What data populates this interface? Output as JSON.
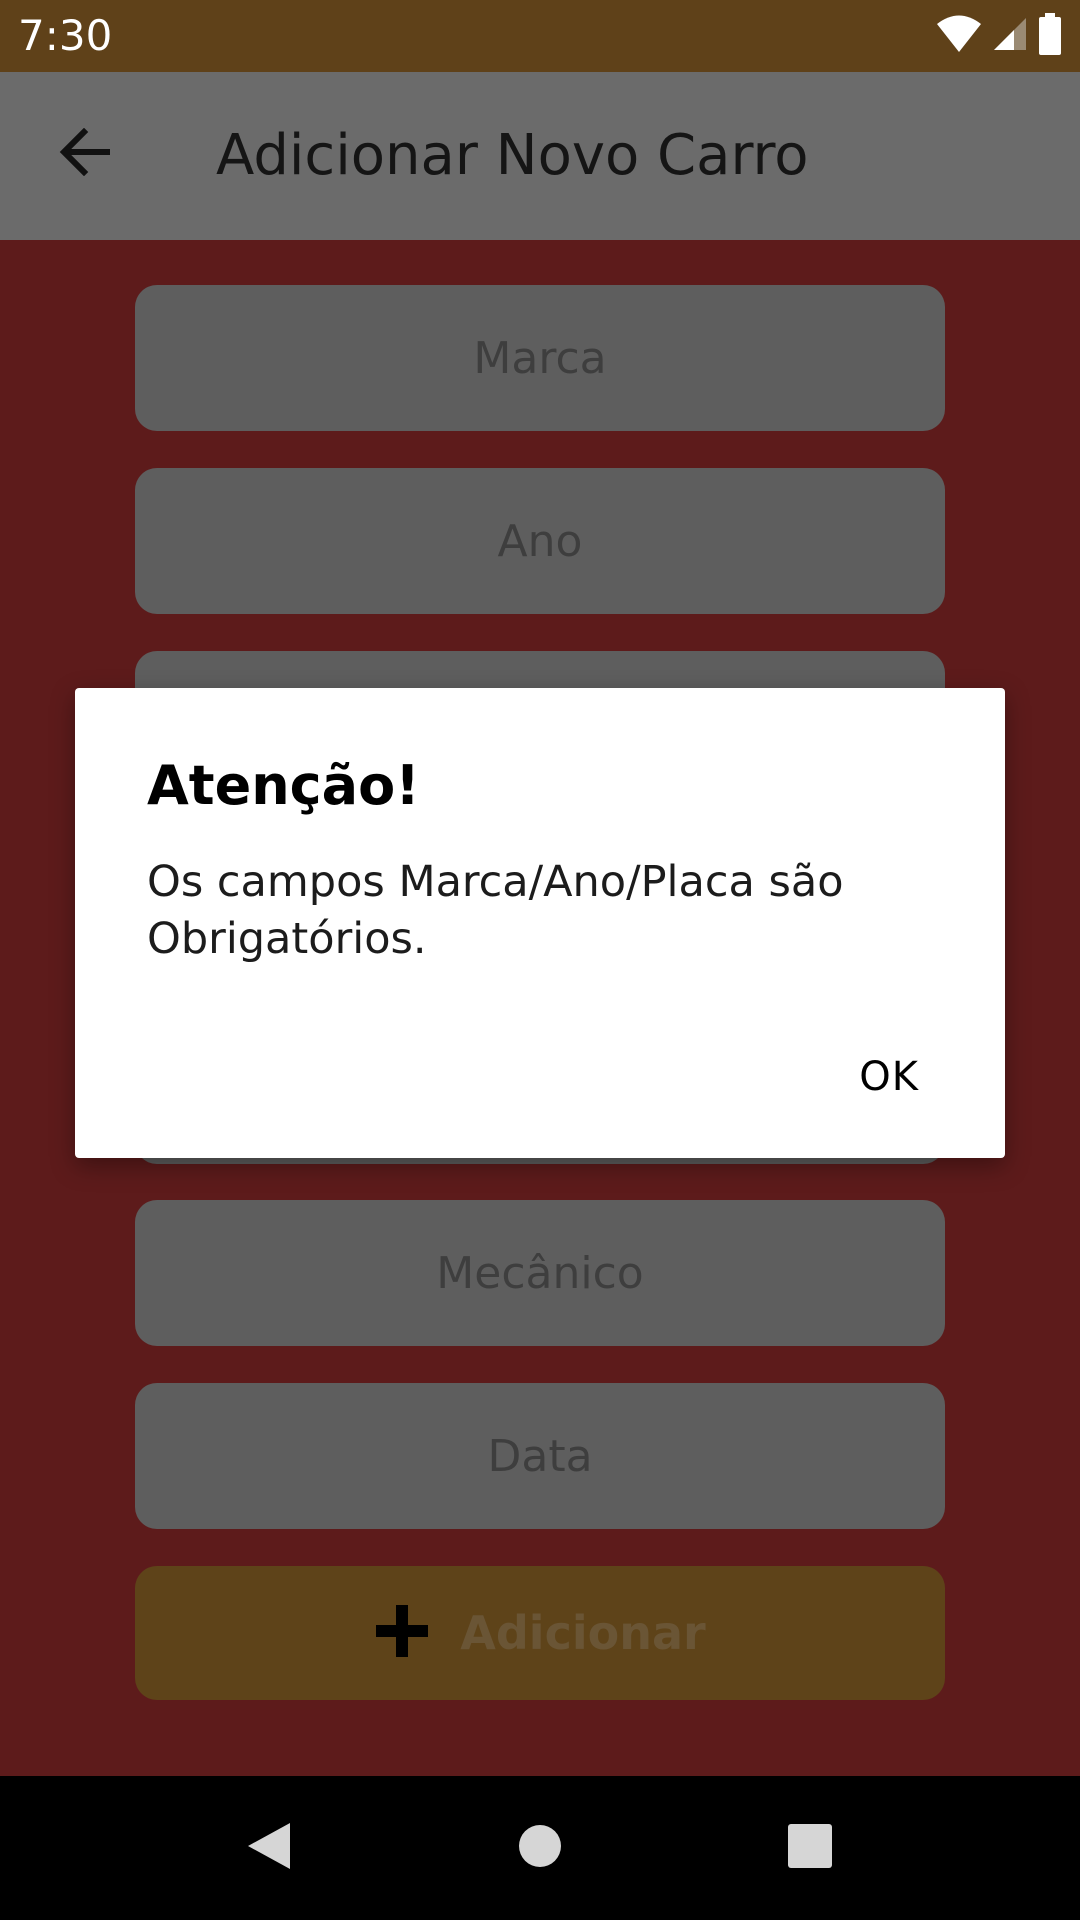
{
  "status_bar": {
    "time": "7:30",
    "icons": [
      "wifi-icon",
      "cell-signal-icon",
      "battery-icon"
    ]
  },
  "app_bar": {
    "title": "Adicionar Novo Carro",
    "back_icon": "arrow-left-icon"
  },
  "form": {
    "fields": [
      {
        "placeholder": "Marca"
      },
      {
        "placeholder": "Ano"
      },
      {
        "placeholder": ""
      },
      {
        "placeholder": ""
      },
      {
        "placeholder": "Mecânico"
      },
      {
        "placeholder": "Data"
      }
    ],
    "add_button": {
      "label": "Adicionar",
      "icon": "plus-icon"
    }
  },
  "dialog": {
    "title": "Atenção!",
    "message": "Os campos Marca/Ano/Placa são Obrigatórios.",
    "ok_label": "OK"
  },
  "nav_bar": {
    "icons": [
      "back-triangle-icon",
      "home-circle-icon",
      "recents-square-icon"
    ]
  },
  "colors": {
    "status_bar": "#5f4119",
    "app_bar_dimmed": "#6b6b6b",
    "background_dimmed": "#5d1b1b",
    "field_dimmed": "#5e5e5e",
    "add_button_dimmed": "#5e4319",
    "dialog_bg": "#ffffff"
  }
}
